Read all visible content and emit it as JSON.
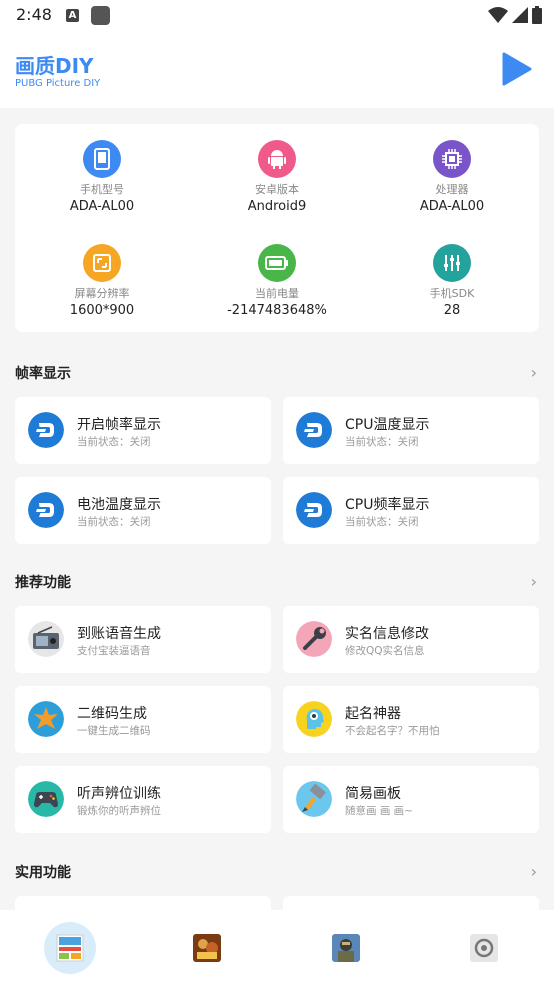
{
  "status_bar": {
    "time": "2:48"
  },
  "app": {
    "title": "画质DIY",
    "subtitle": "PUBG Picture DIY"
  },
  "device_info": [
    {
      "label": "手机型号",
      "value": "ADA-AL00",
      "icon": "phone-icon",
      "color": "#3d8bf2"
    },
    {
      "label": "安卓版本",
      "value": "Android9",
      "icon": "android-icon",
      "color": "#ef5a8a"
    },
    {
      "label": "处理器",
      "value": "ADA-AL00",
      "icon": "cpu-icon",
      "color": "#7a55c9"
    },
    {
      "label": "屏幕分辨率",
      "value": "1600*900",
      "icon": "screen-icon",
      "color": "#f6a623"
    },
    {
      "label": "当前电量",
      "value": "-2147483648%",
      "icon": "battery-icon",
      "color": "#49b649"
    },
    {
      "label": "手机SDK",
      "value": "28",
      "icon": "sliders-icon",
      "color": "#23a39b"
    }
  ],
  "sections": {
    "framerate": {
      "title": "帧率显示",
      "items": [
        {
          "title": "开启帧率显示",
          "sub": "当前状态：关闭"
        },
        {
          "title": "CPU温度显示",
          "sub": "当前状态：关闭"
        },
        {
          "title": "电池温度显示",
          "sub": "当前状态：关闭"
        },
        {
          "title": "CPU频率显示",
          "sub": "当前状态：关闭"
        }
      ]
    },
    "recommended": {
      "title": "推荐功能",
      "items": [
        {
          "title": "到账语音生成",
          "sub": "支付宝装逼语音"
        },
        {
          "title": "实名信息修改",
          "sub": "修改QQ实名信息"
        },
        {
          "title": "二维码生成",
          "sub": "一键生成二维码"
        },
        {
          "title": "起名神器",
          "sub": "不会起名字？不用怕"
        },
        {
          "title": "听声辨位训练",
          "sub": "锻炼你的听声辨位"
        },
        {
          "title": "简易画板",
          "sub": "随意画 画 画~"
        }
      ]
    },
    "utility": {
      "title": "实用功能"
    }
  },
  "colors": {
    "accent": "#3d8bf2",
    "dash_blue": "#1f7bd6"
  }
}
